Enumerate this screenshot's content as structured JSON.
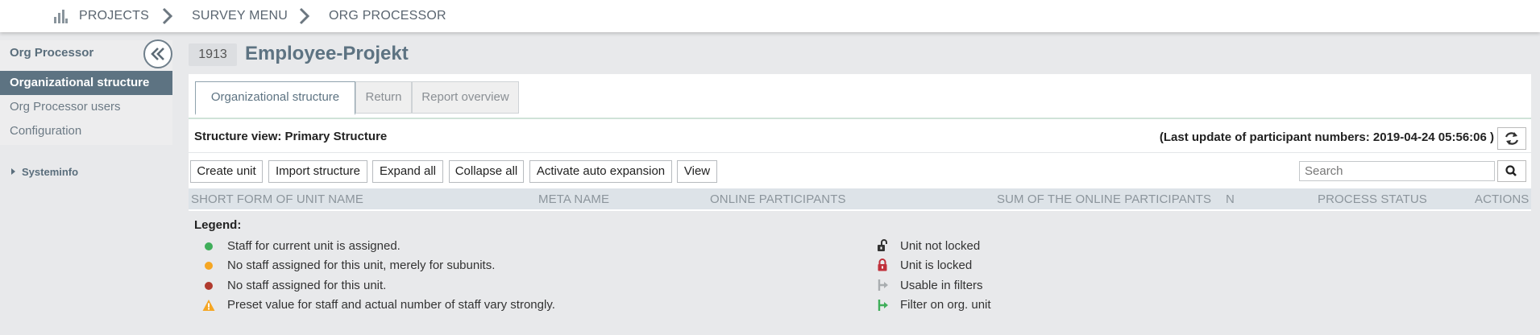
{
  "breadcrumb": [
    "PROJECTS",
    "SURVEY MENU",
    "ORG PROCESSOR"
  ],
  "sidebar": {
    "title": "Org Processor",
    "items": [
      {
        "label": "Organizational structure",
        "active": true
      },
      {
        "label": "Org Processor users",
        "active": false
      },
      {
        "label": "Configuration",
        "active": false
      }
    ],
    "systeminfo": "Systeminfo"
  },
  "project": {
    "number": "1913",
    "title": "Employee-Projekt"
  },
  "tabs": [
    {
      "label": "Organizational structure",
      "active": true
    },
    {
      "label": "Return",
      "active": false
    },
    {
      "label": "Report overview",
      "active": false
    }
  ],
  "structure_view": "Structure view: Primary Structure",
  "last_update": "(Last update of participant numbers: 2019-04-24 05:56:06 )",
  "toolbar": {
    "create_unit": "Create unit",
    "import_structure": "Import structure",
    "expand_all": "Expand all",
    "collapse_all": "Collapse all",
    "activate_auto_expansion": "Activate auto expansion",
    "view": "View"
  },
  "search": {
    "placeholder": "Search",
    "value": ""
  },
  "columns": [
    "SHORT FORM OF UNIT NAME",
    "META NAME",
    "ONLINE PARTICIPANTS",
    "SUM OF THE ONLINE PARTICIPANTS",
    "N",
    "PROCESS STATUS",
    "ACTIONS"
  ],
  "legend": {
    "title": "Legend:",
    "left": [
      {
        "icon": "green-dot-icon",
        "text": "Staff for current unit is assigned."
      },
      {
        "icon": "orange-dot-icon",
        "text": "No staff assigned for this unit, merely for subunits."
      },
      {
        "icon": "red-dot-icon",
        "text": "No staff assigned for this unit."
      },
      {
        "icon": "warning-icon",
        "text": "Preset value for staff and actual number of staff vary strongly."
      }
    ],
    "right": [
      {
        "icon": "unlocked-icon",
        "text": "Unit not locked"
      },
      {
        "icon": "locked-icon",
        "text": "Unit is locked"
      },
      {
        "icon": "filter-usable-icon",
        "text": "Usable in filters"
      },
      {
        "icon": "filter-active-icon",
        "text": "Filter on org. unit"
      }
    ]
  },
  "colors": {
    "accent": "#5d7382",
    "green": "#3fae5a",
    "orange": "#f5a623",
    "red": "#b03a2e"
  }
}
